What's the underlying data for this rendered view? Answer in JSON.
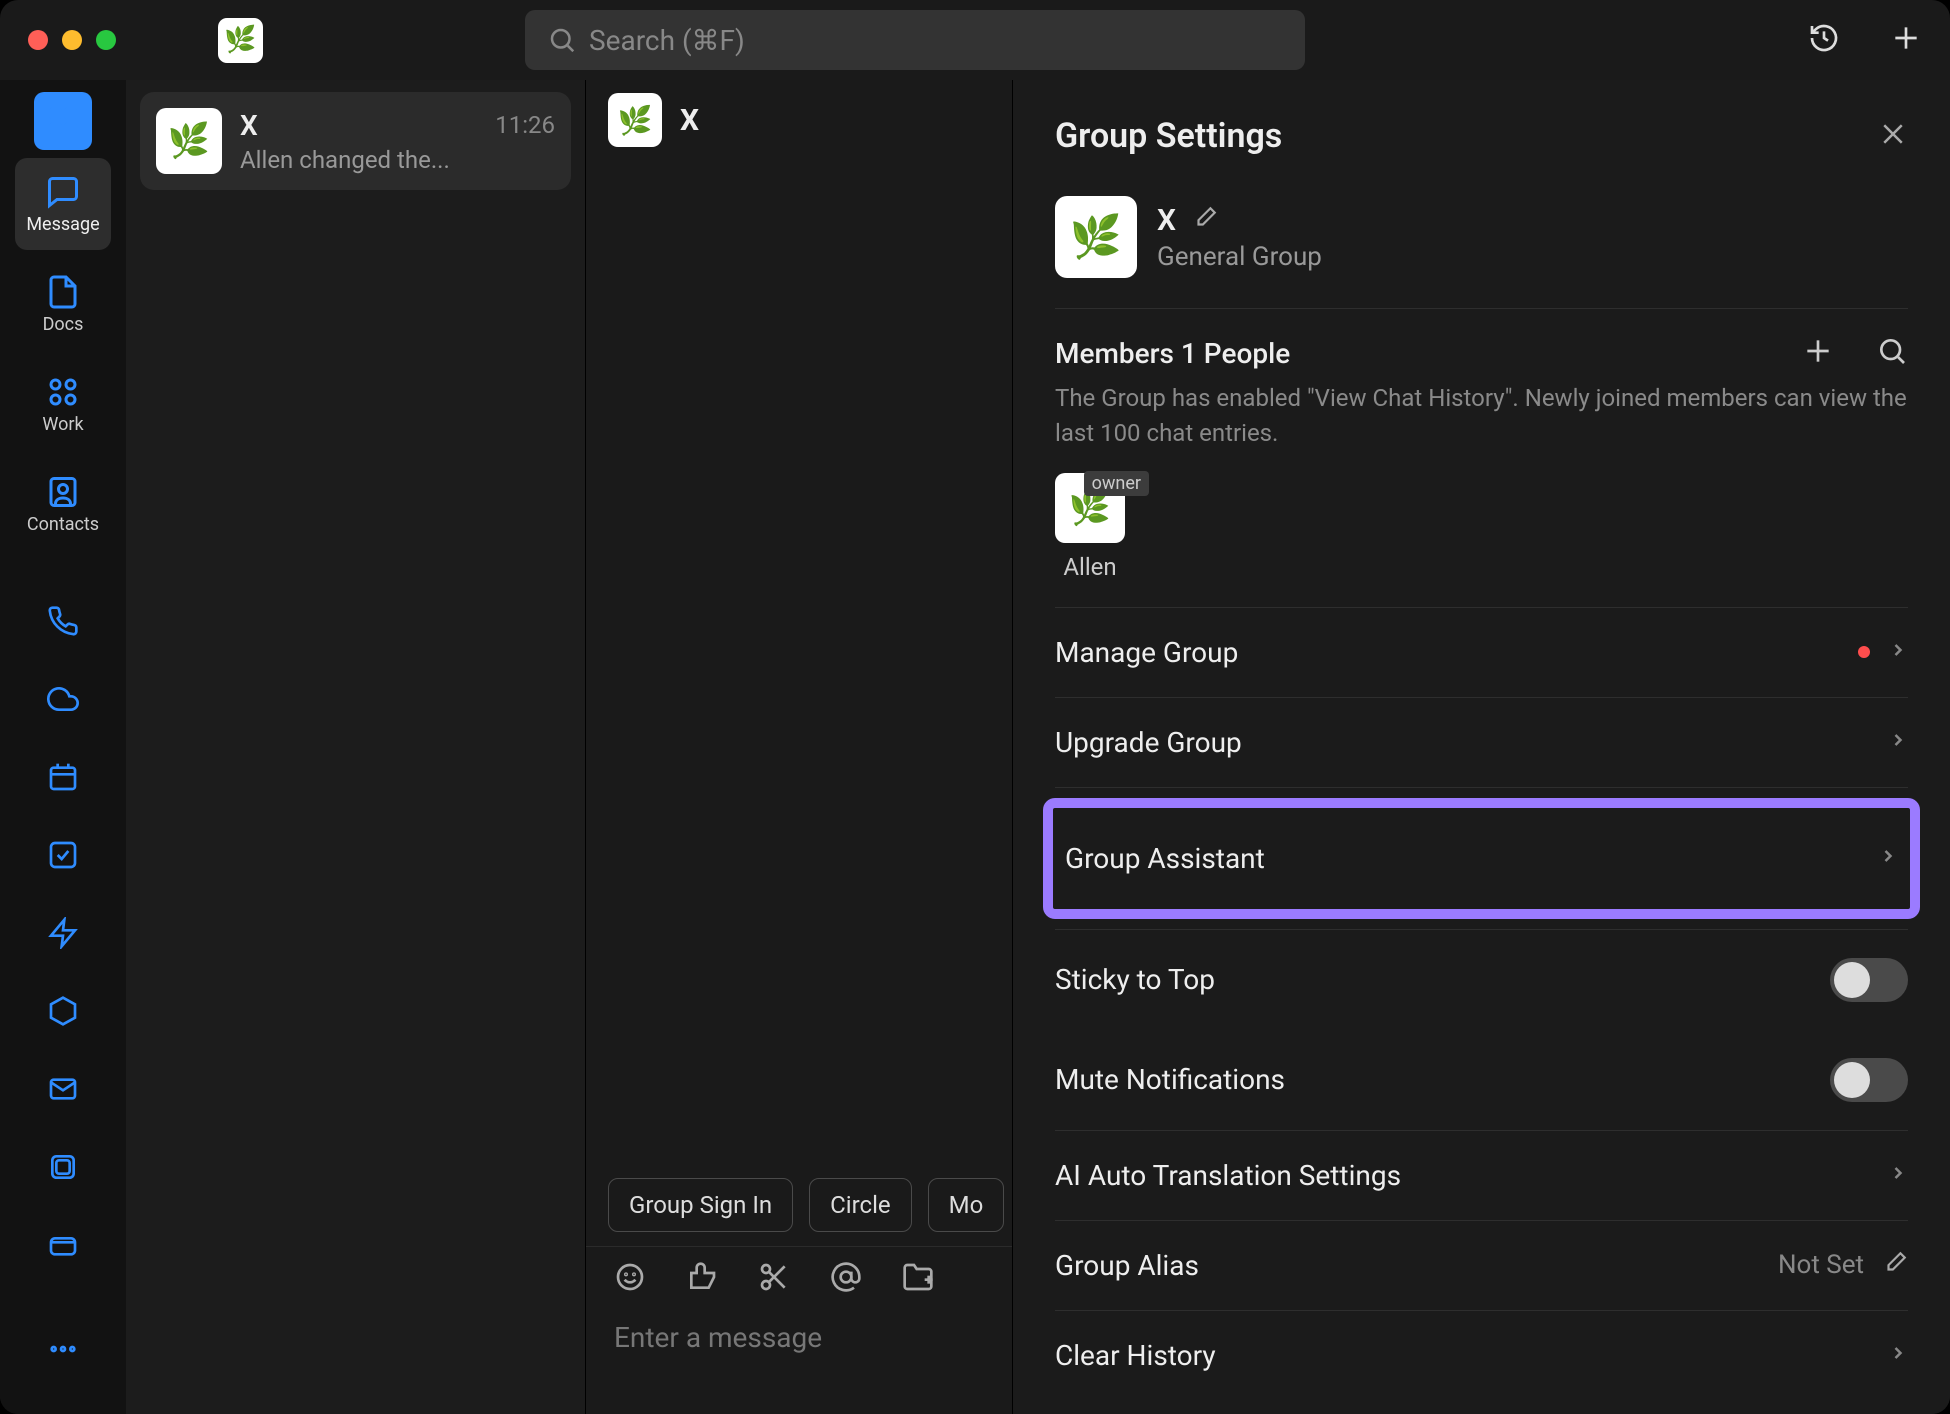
{
  "search": {
    "placeholder": "Search (⌘F)"
  },
  "rail": {
    "message": "Message",
    "docs": "Docs",
    "work": "Work",
    "contacts": "Contacts"
  },
  "conversation": {
    "name": "X",
    "time": "11:26",
    "preview": "Allen changed the..."
  },
  "chat": {
    "title": "X",
    "chips": {
      "sign_in": "Group Sign In",
      "circle": "Circle",
      "more": "Mo"
    },
    "compose_placeholder": "Enter a message"
  },
  "panel": {
    "title": "Group Settings",
    "group_name": "X",
    "group_type": "General Group",
    "members_title": "Members 1 People",
    "members_note": "The Group has enabled \"View Chat History\". Newly joined members can view the last 100 chat entries.",
    "owner_badge": "owner",
    "member_name": "Allen",
    "rows": {
      "manage": "Manage Group",
      "upgrade": "Upgrade Group",
      "assistant": "Group Assistant",
      "sticky": "Sticky to Top",
      "mute": "Mute Notifications",
      "ai_trans": "AI Auto Translation Settings",
      "alias": "Group Alias",
      "alias_value": "Not Set",
      "clear": "Clear History"
    }
  }
}
